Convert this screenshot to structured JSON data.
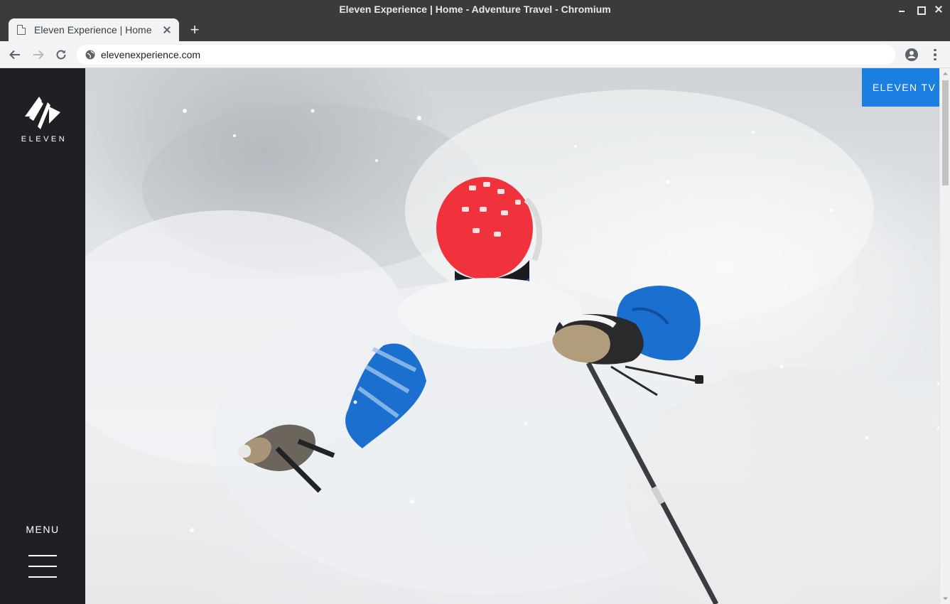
{
  "window": {
    "title": "Eleven Experience | Home - Adventure Travel - Chromium"
  },
  "tab": {
    "title": "Eleven Experience | Home",
    "new_tab_symbol": "+"
  },
  "address_bar": {
    "url": "elevenexperience.com"
  },
  "sidebar": {
    "logo_text": "ELEVEN",
    "menu_label": "MENU"
  },
  "hero": {
    "cta_label": "ELEVEN TV",
    "icons": {
      "next": "chevron-right-icon"
    }
  },
  "colors": {
    "sidebar_bg": "#1f2024",
    "cta_bg": "#1a7fe0",
    "helmet": "#f0323d",
    "jacket": "#1a6fd0",
    "chrome_dark": "#3b3b3b",
    "chrome_light": "#f1f3f4"
  }
}
